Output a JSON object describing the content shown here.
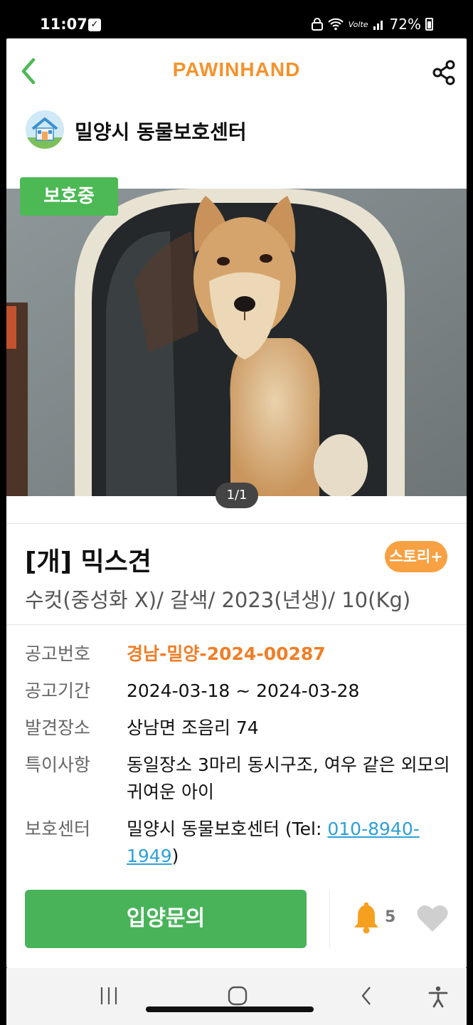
{
  "status_bar": {
    "time": "11:07",
    "network": "Vo",
    "network_sub": "lte",
    "battery": "72%"
  },
  "header": {
    "brand": "PAWINHAND",
    "brand_color": "#f5922b"
  },
  "shelter": {
    "name": "밀양시 동물보호센터"
  },
  "photo": {
    "status": "보호중",
    "counter": "1/1"
  },
  "pet": {
    "title": "[개] 믹스견",
    "story_button": "스토리+",
    "summary": "수컷(중성화 X)/ 갈색/ 2023(년생)/ 10(Kg)"
  },
  "info": {
    "notice_no_label": "공고번호",
    "notice_no": "경남-밀양-2024-00287",
    "period_label": "공고기간",
    "period": "2024-03-18 ~ 2024-03-28",
    "found_label": "발견장소",
    "found": "상남면 조음리 74",
    "notes_label": "특이사항",
    "notes": "동일장소 3마리 동시구조, 여우 같은 외모의 귀여운 아이",
    "center_label": "보호센터",
    "center_prefix": "밀양시 동물보호센터 (Tel: ",
    "center_phone": "010-8940-1949",
    "center_suffix": ")"
  },
  "actions": {
    "adopt_button": "입양문의",
    "bell_count": "5"
  },
  "icons": [
    "back-icon",
    "share-icon",
    "shelter-house-icon",
    "bell-icon",
    "heart-icon",
    "recent-apps-icon",
    "home-icon",
    "nav-back-icon",
    "accessibility-icon"
  ],
  "colors": {
    "accent_green": "#49b35a",
    "accent_orange": "#f07e27",
    "link_blue": "#2ea0d8"
  }
}
